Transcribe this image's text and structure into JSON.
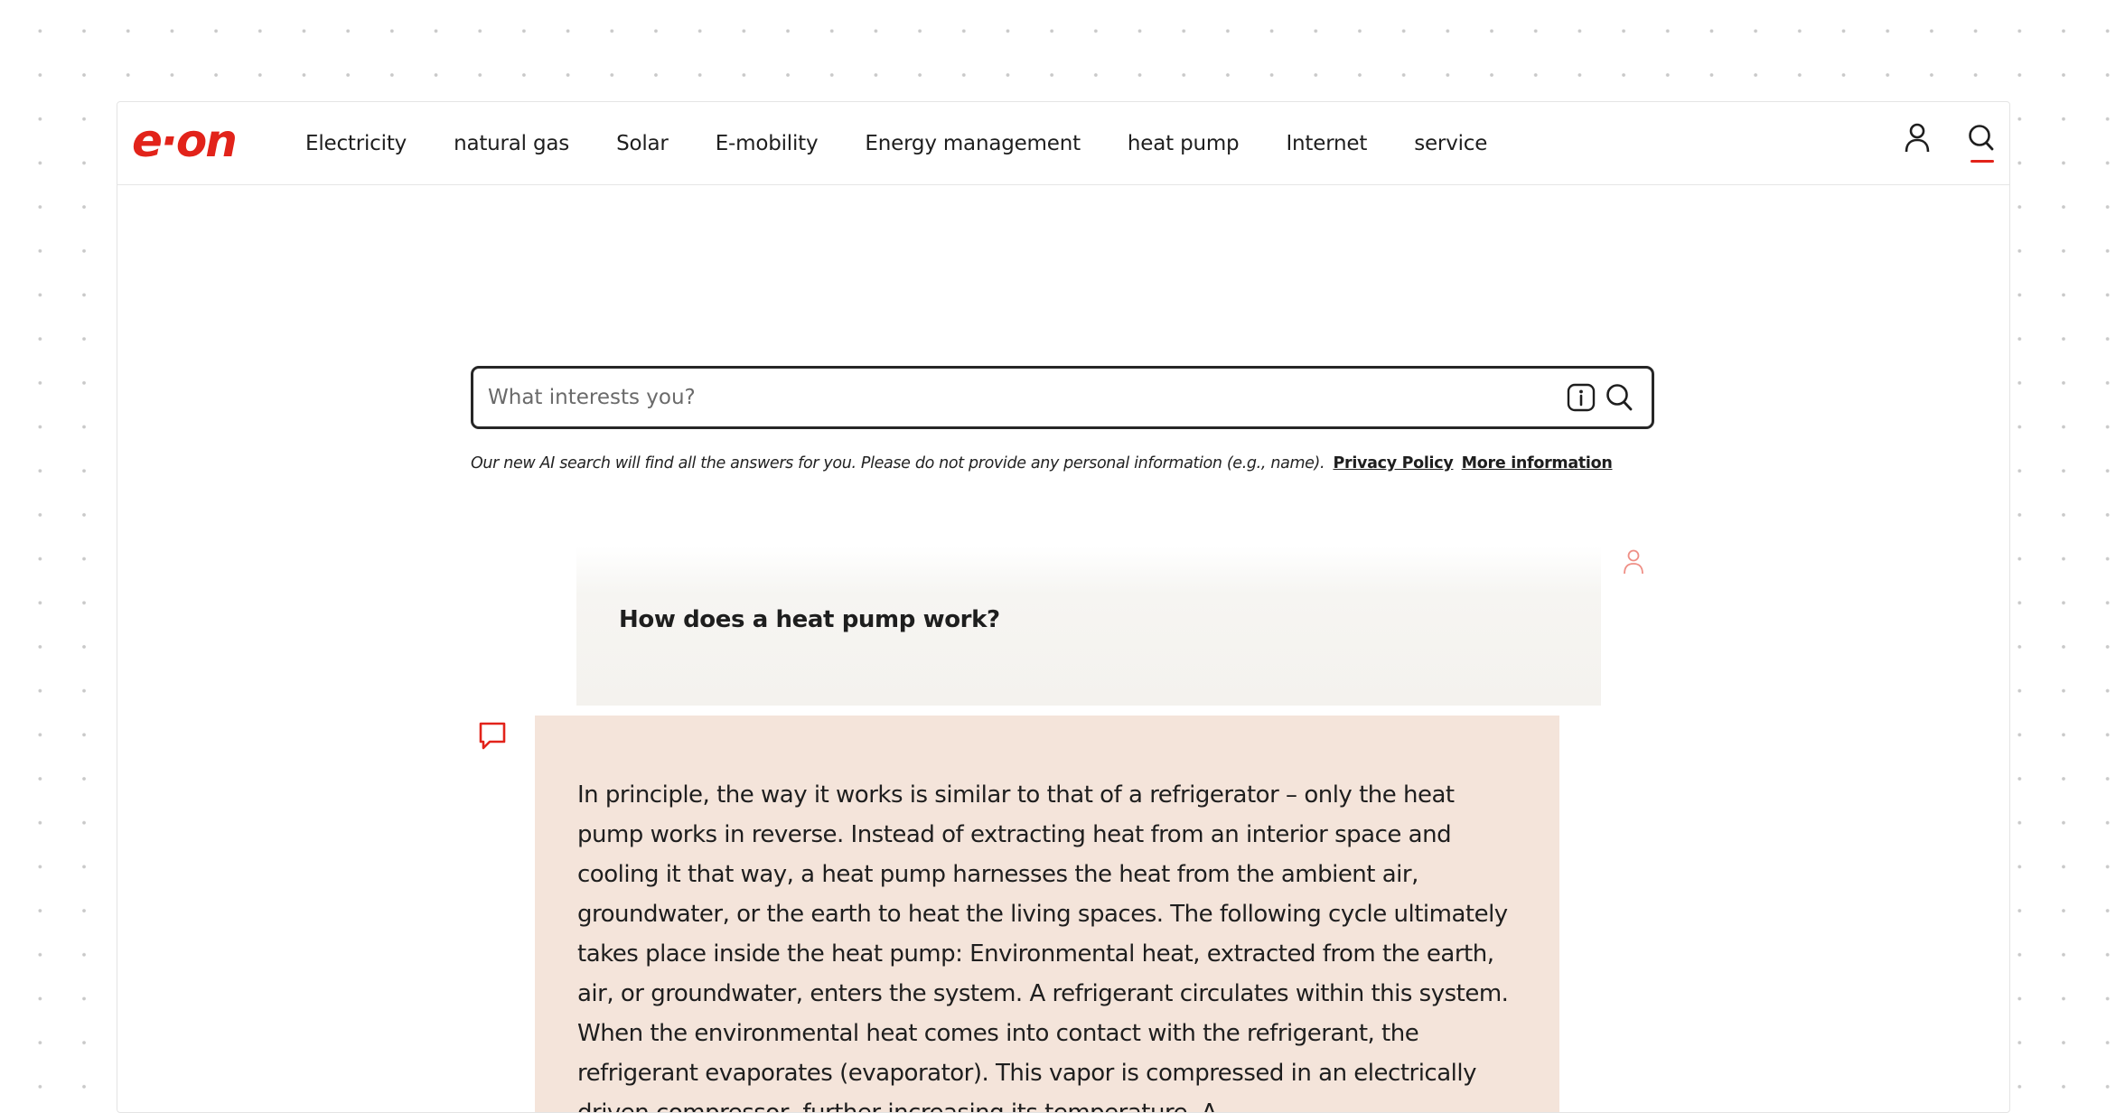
{
  "colors": {
    "brand": "#e2231a",
    "user_bubble": "#f4f2ee",
    "bot_bubble": "#f4e4da",
    "border": "#262626"
  },
  "header": {
    "logo_alt": "e·on",
    "nav": [
      {
        "label": "Electricity"
      },
      {
        "label": "natural gas"
      },
      {
        "label": "Solar"
      },
      {
        "label": "E-mobility"
      },
      {
        "label": "Energy management"
      },
      {
        "label": "heat pump"
      },
      {
        "label": "Internet"
      },
      {
        "label": "service"
      }
    ],
    "icons": {
      "account": "user-icon",
      "search": "search-icon"
    }
  },
  "search": {
    "placeholder": "What interests you?",
    "value": "",
    "icons": {
      "info": "info-icon",
      "submit": "search-icon"
    }
  },
  "disclaimer": {
    "text": "Our new AI search will find all the answers for you. Please do not provide any personal information (e.g., name).",
    "privacy_link": "Privacy Policy",
    "more_link": "More information"
  },
  "conversation": {
    "user_question": "How does a heat pump work?",
    "user_icon": "user-icon",
    "bot_icon": "chat-bubble-icon",
    "bot_answer": "In principle, the way it works is similar to that of a refrigerator – only the heat pump works in reverse. Instead of extracting heat from an interior space and cooling it that way, a heat pump harnesses the heat from the ambient air, groundwater, or the earth to heat the living spaces. The following cycle ultimately takes place inside the heat pump: Environmental heat, extracted from the earth, air, or groundwater, enters the system. A refrigerant circulates within this system. When the environmental heat comes into contact with the refrigerant, the refrigerant evaporates (evaporator). This vapor is compressed in an electrically driven compressor, further increasing its temperature. A"
  }
}
